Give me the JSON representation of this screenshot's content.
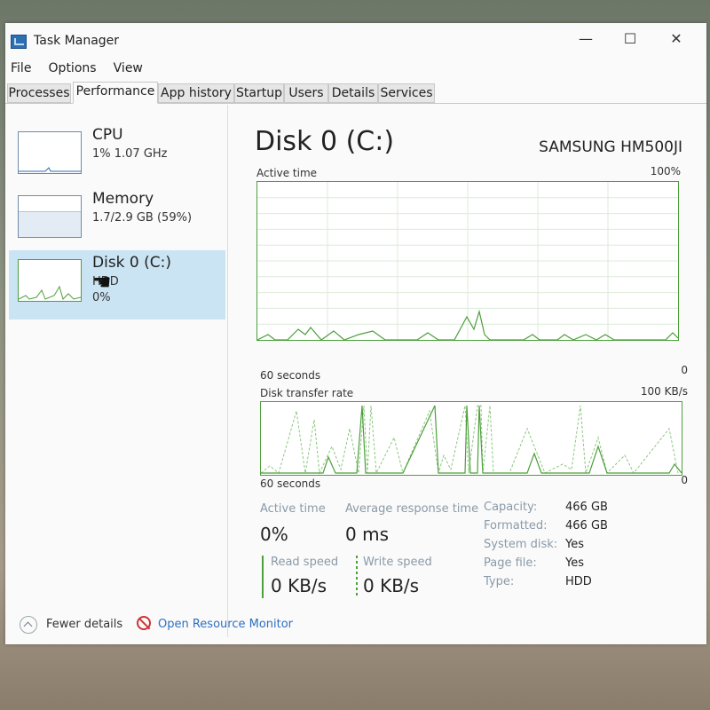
{
  "window": {
    "title": "Task Manager",
    "minimize": "—",
    "maximize": "☐",
    "close": "✕"
  },
  "menu": [
    "File",
    "Options",
    "View"
  ],
  "tabs": [
    "Processes",
    "Performance",
    "App history",
    "Startup",
    "Users",
    "Details",
    "Services"
  ],
  "active_tab": "Performance",
  "resources": [
    {
      "name": "CPU",
      "detail": "1%  1.07 GHz"
    },
    {
      "name": "Memory",
      "detail": "1.7/2.9 GB (59%)"
    },
    {
      "name": "Disk 0 (C:)",
      "detail": "HDD",
      "detail2": "0%"
    }
  ],
  "main": {
    "title": "Disk 0 (C:)",
    "model": "SAMSUNG HM500JI",
    "active_time_label": "Active time",
    "active_time_max": "100%",
    "graph1_xlabel": "60 seconds",
    "graph1_min": "0",
    "transfer_label": "Disk transfer rate",
    "transfer_max": "100 KB/s",
    "graph2_xlabel": "60 seconds",
    "graph2_min": "0"
  },
  "stats": {
    "active_time_label": "Active time",
    "active_time_value": "0%",
    "avg_response_label": "Average response time",
    "avg_response_value": "0 ms",
    "read_speed_label": "Read speed",
    "read_speed_value": "0 KB/s",
    "write_speed_label": "Write speed",
    "write_speed_value": "0 KB/s"
  },
  "properties": [
    {
      "label": "Capacity:",
      "value": "466 GB"
    },
    {
      "label": "Formatted:",
      "value": "466 GB"
    },
    {
      "label": "System disk:",
      "value": "Yes"
    },
    {
      "label": "Page file:",
      "value": "Yes"
    },
    {
      "label": "Type:",
      "value": "HDD"
    }
  ],
  "footer": {
    "fewer_details": "Fewer details",
    "open_resource_monitor": "Open Resource Monitor"
  },
  "colors": {
    "graph_line": "#4d9f3c",
    "selection": "#cbe4f3",
    "link": "#2f6fc0"
  },
  "icons": [
    "task-manager-icon",
    "hand-cursor-icon",
    "chevron-up-icon",
    "resource-monitor-icon"
  ]
}
